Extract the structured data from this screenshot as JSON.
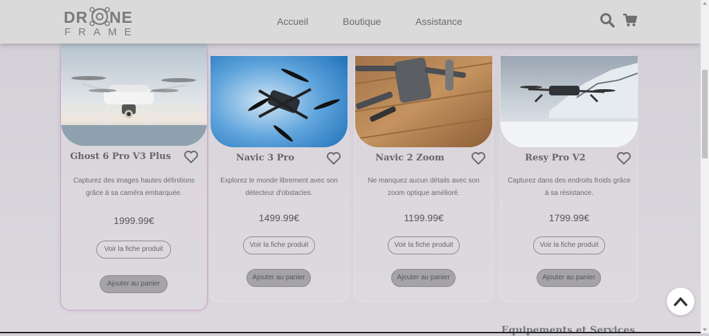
{
  "brand": {
    "logo_line1": "DR NE",
    "logo_line2": "FRAME"
  },
  "nav": {
    "home": "Accueil",
    "shop": "Boutique",
    "help": "Assistance"
  },
  "header_icons": {
    "search": "search-icon",
    "cart": "cart-icon"
  },
  "products": [
    {
      "title": "Ghost 6 Pro V3 Plus",
      "desc": "Capturez des images hautes définitions grâce à sa caméra embarquée.",
      "price": "1999.99€",
      "details_label": "Voir la fiche produit",
      "cart_label": "Ajouter au panier"
    },
    {
      "title": "Navic 3 Pro",
      "desc": "Explorez le monde librement avec son détecteur d'obstacles.",
      "price": "1499.99€",
      "details_label": "Voir la fiche produit",
      "cart_label": "Ajouter au panier"
    },
    {
      "title": "Navic 2 Zoom",
      "desc": "Ne manquez aucun détails avec son zoom optique amélioré.",
      "price": "1199.99€",
      "details_label": "Voir la fiche produit",
      "cart_label": "Ajouter au panier"
    },
    {
      "title": "Resy Pro V2",
      "desc": "Capturez dans des endroits froids grâce à sa résistance.",
      "price": "1799.99€",
      "details_label": "Voir la fiche produit",
      "cart_label": "Ajouter au panier"
    }
  ],
  "section": {
    "title": "Equipements et Services"
  },
  "colors": {
    "header_bg": "#dadada",
    "page_bg": "#d8d4da",
    "featured_border": "#c8a6c8",
    "button_fill": "#a5a3a7"
  }
}
